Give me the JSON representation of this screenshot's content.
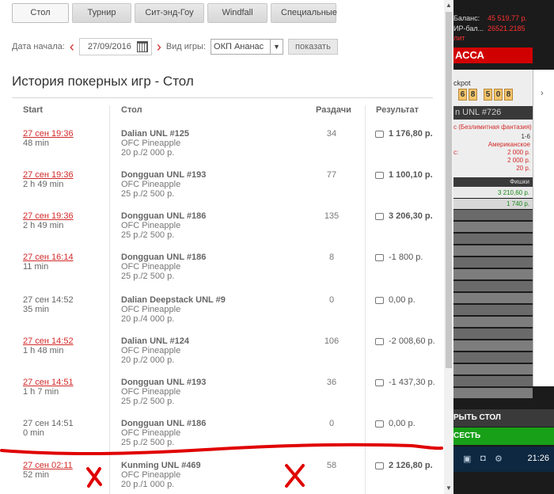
{
  "tabs": [
    {
      "label": "Стол",
      "active": true
    },
    {
      "label": "Турнир",
      "active": false
    },
    {
      "label": "Сит-энд-Гоу",
      "active": false
    },
    {
      "label": "Windfall",
      "active": false
    },
    {
      "label": "Специальные",
      "active": false
    }
  ],
  "filters": {
    "start_label": "Дата начала:",
    "start_date": "27/09/2016",
    "game_label": "Вид игры:",
    "game_value": "ОКП Ананас",
    "show_label": "показать"
  },
  "title": "История покерных игр - Стол",
  "columns": {
    "start": "Start",
    "table": "Стол",
    "hands": "Раздачи",
    "result": "Результат"
  },
  "rows": [
    {
      "date": "27 сен 19:36",
      "link": true,
      "duration": "48 min",
      "table": "Dalian UNL #125",
      "game": "OFC Pineapple",
      "stakes": "20 р./2 000 р.",
      "hands": "34",
      "result": "1 176,80 р.",
      "positive": true
    },
    {
      "date": "27 сен 19:36",
      "link": true,
      "duration": "2 h 49 min",
      "table": "Dongguan UNL #193",
      "game": "OFC Pineapple",
      "stakes": "25 р./2 500 р.",
      "hands": "77",
      "result": "1 100,10 р.",
      "positive": true
    },
    {
      "date": "27 сен 19:36",
      "link": true,
      "duration": "2 h 49 min",
      "table": "Dongguan UNL #186",
      "game": "OFC Pineapple",
      "stakes": "25 р./2 500 р.",
      "hands": "135",
      "result": "3 206,30 р.",
      "positive": true
    },
    {
      "date": "27 сен 16:14",
      "link": true,
      "duration": "11 min",
      "table": "Dongguan UNL #186",
      "game": "OFC Pineapple",
      "stakes": "25 р./2 500 р.",
      "hands": "8",
      "result": "-1 800 р.",
      "positive": false
    },
    {
      "date": "27 сен 14:52",
      "link": false,
      "duration": "35 min",
      "table": "Dalian Deepstack UNL #9",
      "game": "OFC Pineapple",
      "stakes": "20 р./4 000 р.",
      "hands": "0",
      "result": "0,00 р.",
      "positive": false
    },
    {
      "date": "27 сен 14:52",
      "link": true,
      "duration": "1 h 48 min",
      "table": "Dalian UNL #124",
      "game": "OFC Pineapple",
      "stakes": "20 р./2 000 р.",
      "hands": "106",
      "result": "-2 008,60 р.",
      "positive": false
    },
    {
      "date": "27 сен 14:51",
      "link": true,
      "duration": "1 h 7 min",
      "table": "Dongguan UNL #193",
      "game": "OFC Pineapple",
      "stakes": "25 р./2 500 р.",
      "hands": "36",
      "result": "-1 437,30 р.",
      "positive": false
    },
    {
      "date": "27 сен 14:51",
      "link": false,
      "duration": "0 min",
      "table": "Dongguan UNL #186",
      "game": "OFC Pineapple",
      "stakes": "25 р./2 500 р.",
      "hands": "0",
      "result": "0,00 р.",
      "positive": false
    },
    {
      "date": "27 сен 02:11",
      "link": true,
      "duration": "52 min",
      "table": "Kunming UNL #469",
      "game": "OFC Pineapple",
      "stakes": "20 р./1 000 р.",
      "hands": "58",
      "result": "2 126,80 р.",
      "positive": true
    }
  ],
  "side": {
    "balance_label": "Баланс:",
    "balance_value": "45 519,77 р.",
    "bonus_label": "ИР-бал...",
    "bonus_value": "26521.2185",
    "limit_text": "лит",
    "cashier": "АССА",
    "jackpot_label": "ckpot",
    "jackpot_digits": [
      "6",
      "8",
      "5",
      "0",
      "8"
    ],
    "table_name": "n UNL #726",
    "game_name": "с (Безлимитная фантазия)",
    "seats": "1-6",
    "game_type": "Американское",
    "blind_label": "с:",
    "blind1": "2 000 р.",
    "blind2": "2 000 р.",
    "blind3": "20 р.",
    "chips_header": "Фишки",
    "chip1": "3 210,60 р.",
    "chip2": "1 740 р.",
    "open_table": "РЫТЬ СТОЛ",
    "sit": "СЕСТЬ",
    "clock": "21:26"
  }
}
